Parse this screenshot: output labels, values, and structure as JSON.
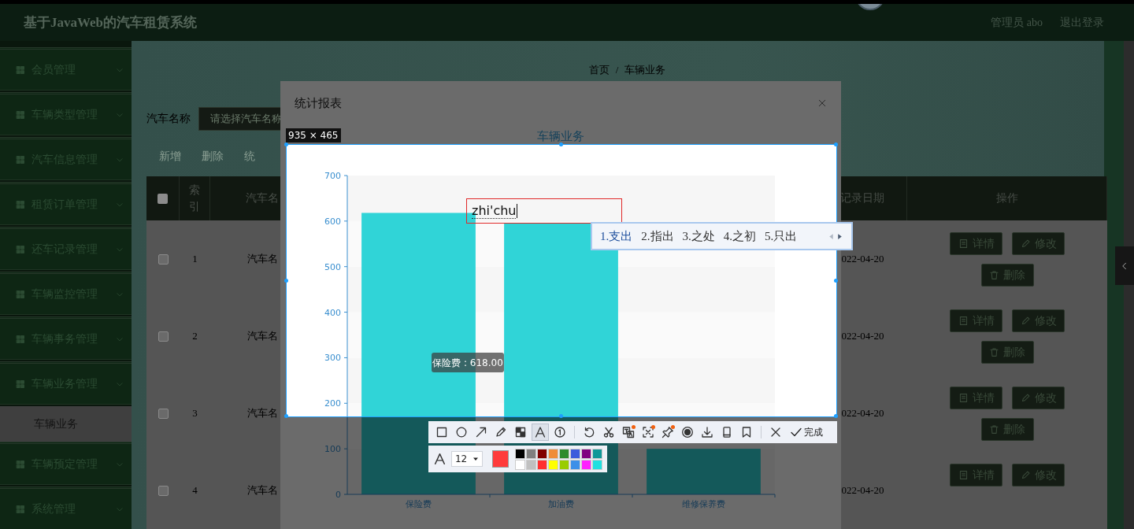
{
  "header": {
    "title": "基于JavaWeb的汽车租赁系统",
    "user": "管理员 abo",
    "logout": "退出登录"
  },
  "sidebar": {
    "items": [
      {
        "label": "会员管理"
      },
      {
        "label": "车辆类型管理"
      },
      {
        "label": "汽车信息管理"
      },
      {
        "label": "租赁订单管理"
      },
      {
        "label": "还车记录管理"
      },
      {
        "label": "车辆监控管理"
      },
      {
        "label": "车辆事务管理"
      },
      {
        "label": "车辆业务管理",
        "children": [
          {
            "label": "车辆业务",
            "selected": true
          }
        ]
      },
      {
        "label": "车辆预定管理"
      },
      {
        "label": "系统管理"
      }
    ]
  },
  "breadcrumb": {
    "items": [
      "首页",
      "车辆业务"
    ],
    "separator": "/"
  },
  "search": {
    "label": "汽车名称",
    "placeholder": "请选择汽车名称"
  },
  "actions": [
    "新增",
    "删除",
    "统"
  ],
  "table": {
    "header_checked": false,
    "columns": [
      "索引",
      "汽车名",
      "记录日期",
      "操作"
    ],
    "rows": [
      {
        "checked": false,
        "index": "1",
        "name": "汽车名",
        "date": "022-04-20",
        "buttons": [
          "详情",
          "修改",
          "删除"
        ]
      },
      {
        "checked": false,
        "index": "2",
        "name": "汽车名",
        "date": "022-04-20",
        "buttons": [
          "详情",
          "修改",
          "删除"
        ]
      },
      {
        "checked": false,
        "index": "3",
        "name": "汽车名",
        "date": "022-04-20",
        "buttons": [
          "详情",
          "修改",
          "删除"
        ]
      },
      {
        "checked": false,
        "index": "4",
        "name": "汽车名",
        "date": "022-04-20",
        "buttons": [
          "详情",
          "修改"
        ]
      }
    ]
  },
  "modal": {
    "title": "统计报表",
    "tooltip": "保险费 : 618.00",
    "chart_data": {
      "type": "bar",
      "title": "车辆业务",
      "categories": [
        "保险费",
        "加油费",
        "维修保养费"
      ],
      "series": [
        {
          "color": "#30d4d7",
          "values": [
            618,
            596,
            100
          ]
        }
      ],
      "ylim": [
        0,
        700
      ],
      "yticks": [
        0,
        100,
        200,
        300,
        400,
        500,
        600,
        700
      ]
    }
  },
  "capture": {
    "size": "935 × 465",
    "text": "zhi'chu",
    "candidates": [
      {
        "label": "1.支出",
        "selected": true
      },
      {
        "label": "2.指出",
        "selected": false
      },
      {
        "label": "3.之处",
        "selected": false
      },
      {
        "label": "4.之初",
        "selected": false
      },
      {
        "label": "5.只出",
        "selected": false
      }
    ],
    "tool_groups": [
      [
        {
          "selected": false,
          "badge": false
        },
        {
          "selected": false,
          "badge": false
        },
        {
          "selected": false,
          "badge": false
        },
        {
          "selected": false,
          "badge": false
        },
        {
          "selected": false,
          "badge": false
        },
        {
          "selected": true,
          "badge": false
        },
        {
          "selected": false,
          "badge": false
        }
      ],
      [
        {
          "selected": false,
          "badge": false
        },
        {
          "selected": false,
          "badge": false
        },
        {
          "selected": false,
          "badge": true
        },
        {
          "selected": false,
          "badge": true
        },
        {
          "selected": false,
          "badge": true
        },
        {
          "selected": false,
          "badge": false
        },
        {
          "selected": false,
          "badge": false
        },
        {
          "selected": false,
          "badge": false
        },
        {
          "selected": false,
          "badge": false
        }
      ],
      [
        {
          "selected": false,
          "badge": false
        }
      ]
    ],
    "done": "完成",
    "font_size": "12",
    "current": {
      "color": "#ff3b3b"
    },
    "palette": [
      {
        "color": "#000000"
      },
      {
        "color": "#808080"
      },
      {
        "color": "#800000"
      },
      {
        "color": "#f08c38"
      },
      {
        "color": "#2e8b2e"
      },
      {
        "color": "#3c5cdc"
      },
      {
        "color": "#800080"
      },
      {
        "color": "#109898"
      },
      {
        "color": "#ffffff"
      },
      {
        "color": "#c0c0c0"
      },
      {
        "color": "#ff3030"
      },
      {
        "color": "#ffff00"
      },
      {
        "color": "#99cc00"
      },
      {
        "color": "#3c90e8"
      },
      {
        "color": "#ff20ff"
      },
      {
        "color": "#20e0e0"
      }
    ]
  }
}
